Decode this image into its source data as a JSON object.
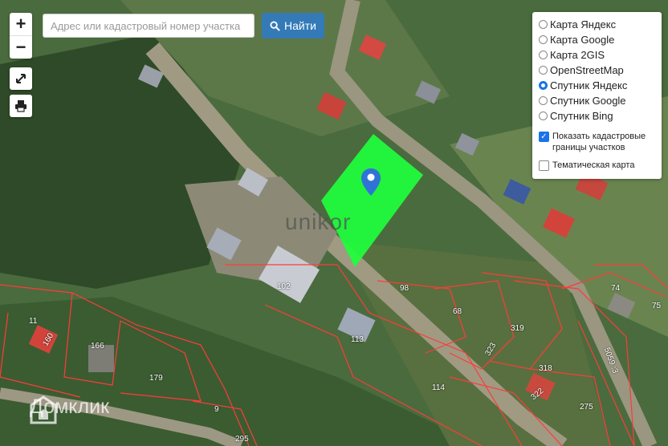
{
  "search": {
    "placeholder": "Адрес или кадастровый номер участка",
    "button_label": "Найти"
  },
  "zoom": {
    "in_label": "+",
    "out_label": "−"
  },
  "layers": {
    "options": [
      {
        "label": "Карта Яндекс",
        "selected": false
      },
      {
        "label": "Карта Google",
        "selected": false
      },
      {
        "label": "Карта 2GIS",
        "selected": false
      },
      {
        "label": "OpenStreetMap",
        "selected": false
      },
      {
        "label": "Спутник Яндекс",
        "selected": true
      },
      {
        "label": "Спутник Google",
        "selected": false
      },
      {
        "label": "Спутник Bing",
        "selected": false
      }
    ],
    "show_cadastral": {
      "label": "Показать кадастровые границы участков",
      "checked": true
    },
    "thematic": {
      "label": "Тематическая карта",
      "checked": false
    }
  },
  "parcel_numbers": [
    "102",
    "98",
    "11",
    "160",
    "166",
    "179",
    "113",
    "68",
    "319",
    "323",
    "74",
    "75",
    "318",
    "322",
    "5059 :3",
    "114",
    "9",
    "275",
    "295"
  ],
  "brand_text": "unikor",
  "watermark": "Домклик",
  "colors": {
    "highlight": "#1eff3c",
    "cadastral": "#ff3b3b",
    "accent": "#337ab7",
    "marker": "#2f73d6"
  }
}
